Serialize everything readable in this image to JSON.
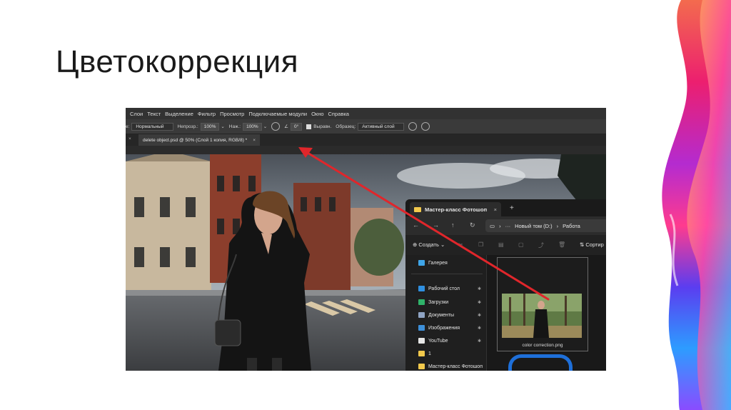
{
  "slide": {
    "title": "Цветокоррекция"
  },
  "photoshop": {
    "menu": [
      "Слои",
      "Текст",
      "Выделение",
      "Фильтр",
      "Просмотр",
      "Подключаемые модули",
      "Окно",
      "Справка"
    ],
    "options": {
      "mode_label": "е:",
      "mode_value": "Нормальный",
      "opacity_label": "Непрозр.:",
      "opacity_value": "100%",
      "pressure_label": "Наж.:",
      "pressure_value": "100%",
      "angle_value": "0°",
      "align_label": "Выравн.",
      "sample_label": "Образец:",
      "sample_value": "Активный слой"
    },
    "document_tab": "delete object.psd @ 50% (Слой 1 копия, RGB/8) *"
  },
  "explorer": {
    "tab_title": "Мастер-класс Фотошоп",
    "address": [
      "Новый том (D:)",
      "Работа"
    ],
    "create_label": "Создать",
    "sort_label": "Сортир",
    "nav_items": [
      {
        "label": "Галерея",
        "icon": "gallery-icon",
        "pinned": false
      },
      {
        "label": "Рабочий стол",
        "icon": "desktop-icon",
        "pinned": true
      },
      {
        "label": "Загрузки",
        "icon": "downloads-icon",
        "pinned": true
      },
      {
        "label": "Документы",
        "icon": "documents-icon",
        "pinned": true
      },
      {
        "label": "Изображения",
        "icon": "pictures-icon",
        "pinned": true
      },
      {
        "label": "YouTube",
        "icon": "file-icon",
        "pinned": true
      },
      {
        "label": "1",
        "icon": "folder-icon",
        "pinned": false
      },
      {
        "label": "Мастер-класс Фотошоп",
        "icon": "folder-icon",
        "pinned": false
      }
    ],
    "file_name": "color correction.png"
  },
  "colors": {
    "arrow": "#e0262b",
    "accent_blue": "#1e6fd9",
    "folder": "#f2c94c"
  }
}
